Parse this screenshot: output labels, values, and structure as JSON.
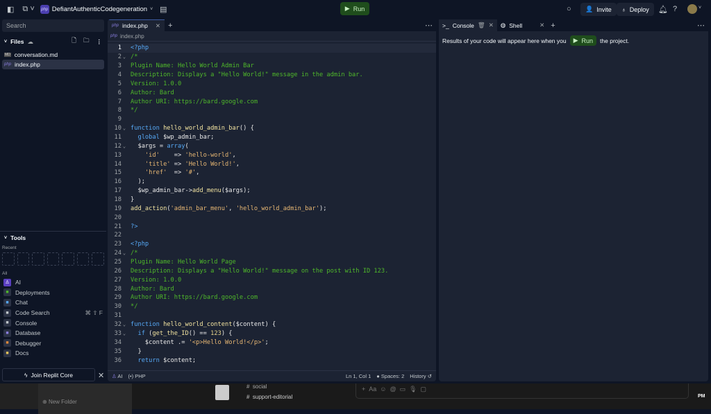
{
  "topbar": {
    "project_name": "DefiantAuthenticCodegeneration",
    "run_label": "Run",
    "invite_label": "Invite",
    "deploy_label": "Deploy"
  },
  "sidebar": {
    "search_placeholder": "Search",
    "files_title": "Files",
    "files": [
      {
        "name": "conversation.md",
        "icon": "markdown-icon"
      },
      {
        "name": "index.php",
        "icon": "php-icon",
        "selected": true
      }
    ],
    "tools_title": "Tools",
    "recent_label": "Recent",
    "all_label": "All",
    "tools": [
      {
        "label": "AI",
        "icon": "ai-icon",
        "color": "#6b4fd8"
      },
      {
        "label": "Deployments",
        "icon": "deploy-icon",
        "color": "#4fb82a"
      },
      {
        "label": "Chat",
        "icon": "chat-icon",
        "color": "#56a8f5"
      },
      {
        "label": "Code Search",
        "icon": "search-icon",
        "shortcut": "⌘ ⇧ F"
      },
      {
        "label": "Console",
        "icon": "console-icon"
      },
      {
        "label": "Database",
        "icon": "database-icon",
        "color": "#8a7ee0"
      },
      {
        "label": "Debugger",
        "icon": "debugger-icon",
        "color": "#e0893a"
      },
      {
        "label": "Docs",
        "icon": "docs-icon",
        "color": "#e6c35a"
      }
    ],
    "join_label": "Join Replit Core"
  },
  "editor": {
    "tab_label": "index.php",
    "breadcrumb": "index.php",
    "lines": [
      [
        [
          "kw",
          "<?php"
        ]
      ],
      [
        [
          "cm",
          "/*"
        ]
      ],
      [
        [
          "cm",
          "Plugin Name: Hello World Admin Bar"
        ]
      ],
      [
        [
          "cm",
          "Description: Displays a \"Hello World!\" message in the admin bar."
        ]
      ],
      [
        [
          "cm",
          "Version: 1.0.0"
        ]
      ],
      [
        [
          "cm",
          "Author: Bard"
        ]
      ],
      [
        [
          "cm",
          "Author URI: https://bard.google.com"
        ]
      ],
      [
        [
          "cm",
          "*/"
        ]
      ],
      [],
      [
        [
          "kw",
          "function "
        ],
        [
          "fn",
          "hello_world_admin_bar"
        ],
        [
          "tx",
          "() {"
        ]
      ],
      [
        [
          "tx",
          "  "
        ],
        [
          "kw",
          "global "
        ],
        [
          "vr",
          "$wp_admin_bar;"
        ]
      ],
      [
        [
          "tx",
          "  "
        ],
        [
          "vr",
          "$args"
        ],
        [
          "tx",
          " = "
        ],
        [
          "kw",
          "array"
        ],
        [
          "tx",
          "("
        ]
      ],
      [
        [
          "tx",
          "    "
        ],
        [
          "str",
          "'id'"
        ],
        [
          "tx",
          "    => "
        ],
        [
          "str",
          "'hello-world'"
        ],
        [
          "tx",
          ","
        ]
      ],
      [
        [
          "tx",
          "    "
        ],
        [
          "str",
          "'title'"
        ],
        [
          "tx",
          " => "
        ],
        [
          "str",
          "'Hello World!'"
        ],
        [
          "tx",
          ","
        ]
      ],
      [
        [
          "tx",
          "    "
        ],
        [
          "str",
          "'href'"
        ],
        [
          "tx",
          "  => "
        ],
        [
          "str",
          "'#'"
        ],
        [
          "tx",
          ","
        ]
      ],
      [
        [
          "tx",
          "  );"
        ]
      ],
      [
        [
          "tx",
          "  "
        ],
        [
          "vr",
          "$wp_admin_bar"
        ],
        [
          "tx",
          "->"
        ],
        [
          "fn",
          "add_menu"
        ],
        [
          "tx",
          "($args);"
        ]
      ],
      [
        [
          "tx",
          "}"
        ]
      ],
      [
        [
          "fn",
          "add_action"
        ],
        [
          "tx",
          "("
        ],
        [
          "str",
          "'admin_bar_menu'"
        ],
        [
          "tx",
          ", "
        ],
        [
          "str",
          "'hello_world_admin_bar'"
        ],
        [
          "tx",
          ");"
        ]
      ],
      [],
      [
        [
          "kw",
          "?>"
        ]
      ],
      [],
      [
        [
          "kw",
          "<?php"
        ]
      ],
      [
        [
          "cm",
          "/*"
        ]
      ],
      [
        [
          "cm",
          "Plugin Name: Hello World Page"
        ]
      ],
      [
        [
          "cm",
          "Description: Displays a \"Hello World!\" message on the post with ID 123."
        ]
      ],
      [
        [
          "cm",
          "Version: 1.0.0"
        ]
      ],
      [
        [
          "cm",
          "Author: Bard"
        ]
      ],
      [
        [
          "cm",
          "Author URI: https://bard.google.com"
        ]
      ],
      [
        [
          "cm",
          "*/"
        ]
      ],
      [],
      [
        [
          "kw",
          "function "
        ],
        [
          "fn",
          "hello_world_content"
        ],
        [
          "tx",
          "($content) {"
        ]
      ],
      [
        [
          "tx",
          "  "
        ],
        [
          "kw",
          "if "
        ],
        [
          "tx",
          "("
        ],
        [
          "fn",
          "get_the_ID"
        ],
        [
          "tx",
          "() == "
        ],
        [
          "num2",
          "123"
        ],
        [
          "tx",
          ") {"
        ]
      ],
      [
        [
          "tx",
          "    "
        ],
        [
          "vr",
          "$content"
        ],
        [
          "tx",
          " .= "
        ],
        [
          "str",
          "'<p>Hello World!</p>'"
        ],
        [
          "tx",
          ";"
        ]
      ],
      [
        [
          "tx",
          "  }"
        ]
      ],
      [
        [
          "tx",
          "  "
        ],
        [
          "kw",
          "return "
        ],
        [
          "vr",
          "$content;"
        ]
      ]
    ],
    "fold_lines": [
      2,
      10,
      12,
      24,
      32,
      33
    ],
    "status": {
      "ai": "AI",
      "language": "PHP",
      "cursor": "Ln 1, Col 1",
      "spaces": "Spaces: 2",
      "history": "History"
    }
  },
  "console": {
    "tab_console": "Console",
    "tab_shell": "Shell",
    "message_before": "Results of your code will appear here when you",
    "run_label": "Run",
    "message_after": "the project."
  },
  "background": {
    "channels": [
      "social",
      "support-editorial"
    ],
    "new_folder": "New Folder",
    "clock": "PM"
  }
}
